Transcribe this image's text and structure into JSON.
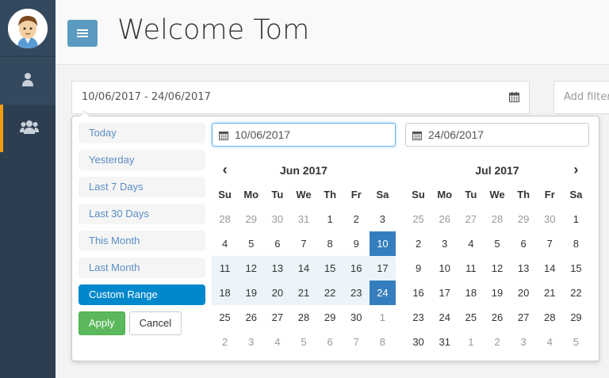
{
  "header": {
    "title": "Welcome Tom"
  },
  "daterange_input": {
    "value": "10/06/2017 - 24/06/2017"
  },
  "filter_input": {
    "placeholder": "Add filter"
  },
  "ranges": [
    "Today",
    "Yesterday",
    "Last 7 Days",
    "Last 30 Days",
    "This Month",
    "Last Month",
    "Custom Range"
  ],
  "active_range": "Custom Range",
  "buttons": {
    "apply": "Apply",
    "cancel": "Cancel"
  },
  "start_date": "10/06/2017",
  "end_date": "24/06/2017",
  "weekdays": [
    "Su",
    "Mo",
    "Tu",
    "We",
    "Th",
    "Fr",
    "Sa"
  ],
  "calendars": [
    {
      "month": "Jun 2017",
      "weeks": [
        [
          "28",
          "29",
          "30",
          "31",
          "1",
          "2",
          "3"
        ],
        [
          "4",
          "5",
          "6",
          "7",
          "8",
          "9",
          "10"
        ],
        [
          "11",
          "12",
          "13",
          "14",
          "15",
          "16",
          "17"
        ],
        [
          "18",
          "19",
          "20",
          "21",
          "22",
          "23",
          "24"
        ],
        [
          "25",
          "26",
          "27",
          "28",
          "29",
          "30",
          "1"
        ],
        [
          "2",
          "3",
          "4",
          "5",
          "6",
          "7",
          "8"
        ]
      ]
    },
    {
      "month": "Jul 2017",
      "weeks": [
        [
          "25",
          "26",
          "27",
          "28",
          "29",
          "30",
          "1"
        ],
        [
          "2",
          "3",
          "4",
          "5",
          "6",
          "7",
          "8"
        ],
        [
          "9",
          "10",
          "11",
          "12",
          "13",
          "14",
          "15"
        ],
        [
          "16",
          "17",
          "18",
          "19",
          "20",
          "21",
          "22"
        ],
        [
          "23",
          "24",
          "25",
          "26",
          "27",
          "28",
          "29"
        ],
        [
          "30",
          "31",
          "1",
          "2",
          "3",
          "4",
          "5"
        ]
      ]
    }
  ],
  "colors": {
    "sidebar": "#2c3e50",
    "accent": "#f39c12",
    "selected": "#357ebd",
    "in_range": "#ebf4f8",
    "apply": "#5cb85c",
    "active_range": "#0088cc"
  }
}
